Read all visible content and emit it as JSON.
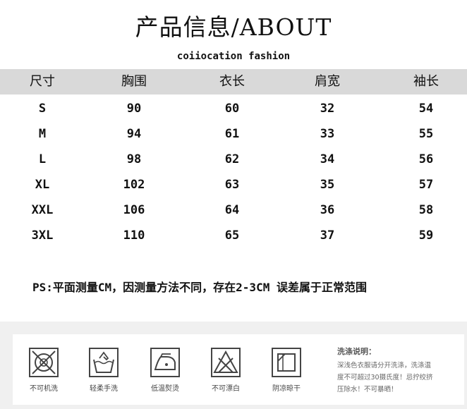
{
  "header": {
    "title": "产品信息/ABOUT",
    "subtitle": "coiiocation fashion"
  },
  "size_table": {
    "columns": [
      "尺寸",
      "胸围",
      "衣长",
      "肩宽",
      "袖长"
    ],
    "rows": [
      [
        "S",
        "90",
        "60",
        "32",
        "54"
      ],
      [
        "M",
        "94",
        "61",
        "33",
        "55"
      ],
      [
        "L",
        "98",
        "62",
        "34",
        "56"
      ],
      [
        "XL",
        "102",
        "63",
        "35",
        "57"
      ],
      [
        "XXL",
        "106",
        "64",
        "36",
        "58"
      ],
      [
        "3XL",
        "110",
        "65",
        "37",
        "59"
      ]
    ]
  },
  "note": "PS:平面测量CM，因测量方法不同，存在2-3CM 误差属于正常范围",
  "care": {
    "icons": [
      {
        "icon": "no-machine-wash-icon",
        "label": "不可机洗"
      },
      {
        "icon": "hand-wash-icon",
        "label": "轻柔手洗"
      },
      {
        "icon": "low-iron-icon",
        "label": "低温熨烫"
      },
      {
        "icon": "no-bleach-icon",
        "label": "不可漂白"
      },
      {
        "icon": "shade-dry-icon",
        "label": "阴凉晾干"
      }
    ],
    "instructions_title": "洗涤说明：",
    "instructions_lines": [
      "深浅色衣服请分开洗涤，洗涤温",
      "度不可超过30摄氏度！忌拧绞挤",
      "压除水！不可暴晒！"
    ]
  }
}
